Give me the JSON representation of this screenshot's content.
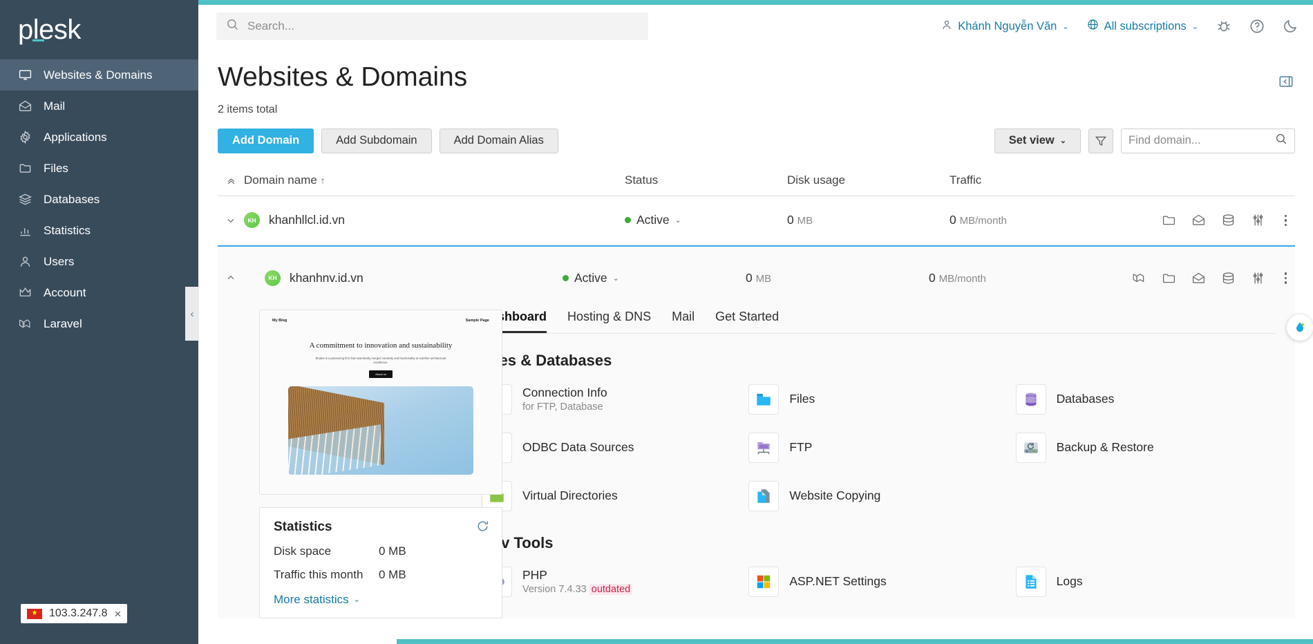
{
  "brand": {
    "name": "plesk"
  },
  "sidebar": {
    "items": [
      {
        "label": "Websites & Domains",
        "icon": "monitor-icon",
        "active": true
      },
      {
        "label": "Mail",
        "icon": "envelope-icon",
        "active": false
      },
      {
        "label": "Applications",
        "icon": "gear-icon",
        "active": false
      },
      {
        "label": "Files",
        "icon": "folder-icon",
        "active": false
      },
      {
        "label": "Databases",
        "icon": "database-stack-icon",
        "active": false
      },
      {
        "label": "Statistics",
        "icon": "bar-chart-icon",
        "active": false
      },
      {
        "label": "Users",
        "icon": "user-icon",
        "active": false
      },
      {
        "label": "Account",
        "icon": "crown-icon",
        "active": false
      },
      {
        "label": "Laravel",
        "icon": "laravel-icon",
        "active": false
      }
    ],
    "ip_badge": {
      "flag": "vietnam-flag",
      "ip": "103.3.247.8",
      "close": "×"
    }
  },
  "topbar": {
    "search_placeholder": "Search...",
    "search_value": "",
    "user": "Khánh Nguyễn Văn",
    "subscriptions": "All subscriptions",
    "icons": [
      "bug-icon",
      "help-icon",
      "dark-mode-icon"
    ]
  },
  "page": {
    "title": "Websites & Domains",
    "items_total": "2 items total"
  },
  "toolbar": {
    "add_domain": "Add Domain",
    "add_subdomain": "Add Subdomain",
    "add_domain_alias": "Add Domain Alias",
    "set_view": "Set view",
    "filter_icon": "filter-icon",
    "find_placeholder": "Find domain...",
    "find_value": ""
  },
  "table": {
    "headers": {
      "name": "Domain name",
      "sort": "↑",
      "status": "Status",
      "disk": "Disk usage",
      "traffic": "Traffic"
    },
    "rows": [
      {
        "avatar": "KH",
        "domain": "khanhllcl.id.vn",
        "status": "Active",
        "disk_value": "0",
        "disk_unit": "MB",
        "traffic_value": "0",
        "traffic_unit": "MB/month",
        "expanded": false,
        "actions": [
          "folder-icon",
          "mail-icon",
          "database-icon",
          "settings-sliders-icon",
          "kebab-icon"
        ]
      },
      {
        "avatar": "KH",
        "domain": "khanhnv.id.vn",
        "status": "Active",
        "disk_value": "0",
        "disk_unit": "MB",
        "traffic_value": "0",
        "traffic_unit": "MB/month",
        "expanded": true,
        "actions": [
          "laravel-icon",
          "folder-icon",
          "mail-icon",
          "database-icon",
          "settings-sliders-icon",
          "kebab-icon"
        ]
      }
    ]
  },
  "preview": {
    "nav_left": "My Blog",
    "nav_right": "Sample Page",
    "heading": "A commitment to innovation and sustainability",
    "paragraph": "Études is a pioneering firm that seamlessly merges creativity and functionality to redefine architectural excellence.",
    "cta": "About us"
  },
  "statistics": {
    "title": "Statistics",
    "refresh_icon": "refresh-icon",
    "rows": [
      {
        "label": "Disk space",
        "value": "0 MB"
      },
      {
        "label": "Traffic this month",
        "value": "0 MB"
      }
    ],
    "more": "More statistics"
  },
  "detail": {
    "tabs": [
      {
        "label": "Dashboard",
        "active": true
      },
      {
        "label": "Hosting & DNS",
        "active": false
      },
      {
        "label": "Mail",
        "active": false
      },
      {
        "label": "Get Started",
        "active": false
      }
    ],
    "sections": [
      {
        "title": "Files & Databases",
        "tiles": [
          {
            "label": "Connection Info",
            "sub": "for FTP, Database",
            "icon": "plug-icon"
          },
          {
            "label": "Files",
            "sub": "",
            "icon": "folder-blue-icon"
          },
          {
            "label": "Databases",
            "sub": "",
            "icon": "database-purple-icon"
          },
          {
            "label": "ODBC Data Sources",
            "sub": "",
            "icon": "odbc-icon"
          },
          {
            "label": "FTP",
            "sub": "",
            "icon": "ftp-icon"
          },
          {
            "label": "Backup & Restore",
            "sub": "",
            "icon": "backup-icon"
          },
          {
            "label": "Virtual Directories",
            "sub": "",
            "icon": "folder-green-icon"
          },
          {
            "label": "Website Copying",
            "sub": "",
            "icon": "copy-icon"
          }
        ]
      },
      {
        "title": "Dev Tools",
        "tiles": [
          {
            "label": "PHP",
            "sub": "Version 7.4.33",
            "sub_badge": "outdated",
            "icon": "php-icon"
          },
          {
            "label": "ASP.NET Settings",
            "sub": "",
            "icon": "windows-icon"
          },
          {
            "label": "Logs",
            "sub": "",
            "icon": "logs-icon"
          }
        ]
      }
    ]
  },
  "colors": {
    "sidebar_bg": "#384b5b",
    "sidebar_active": "#4e6376",
    "teal": "#4fc0c4",
    "primary_blue": "#32b1e3",
    "link_blue": "#177aa8",
    "status_green": "#3faa3c",
    "expanded_border": "#37aee8"
  }
}
